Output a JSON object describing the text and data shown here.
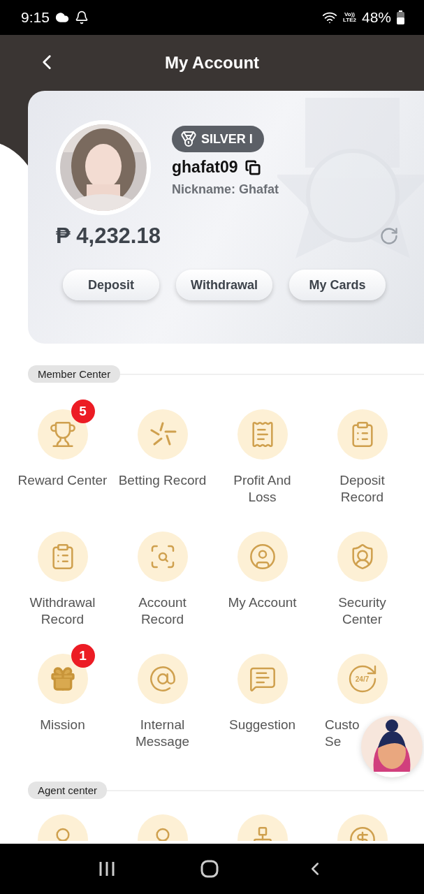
{
  "status_bar": {
    "time": "9:15",
    "volte": "Vo))",
    "network": "LTE2",
    "battery": "48%"
  },
  "header": {
    "title": "My Account"
  },
  "account_card": {
    "rank": "SILVER I",
    "username": "ghafat09",
    "nickname": "Nickname: Ghafat",
    "balance": "₱ 4,232.18",
    "buttons": [
      "Deposit",
      "Withdrawal",
      "My Cards"
    ]
  },
  "sections": [
    {
      "title": "Member Center",
      "items": [
        {
          "kind": "trophy",
          "label": "Reward Center",
          "badge": "5"
        },
        {
          "kind": "burst",
          "label": "Betting Record"
        },
        {
          "kind": "receipt",
          "label": "Profit And\nLoss"
        },
        {
          "kind": "clipboard",
          "label": "Deposit\nRecord"
        },
        {
          "kind": "clipboard",
          "label": "Withdrawal\nRecord"
        },
        {
          "kind": "scan",
          "label": "Account\nRecord"
        },
        {
          "kind": "user",
          "label": "My Account"
        },
        {
          "kind": "shield",
          "label": "Security\nCenter"
        },
        {
          "kind": "gift",
          "label": "Mission",
          "badge": "1"
        },
        {
          "kind": "at",
          "label": "Internal\nMessage"
        },
        {
          "kind": "chat",
          "label": "Suggestion"
        },
        {
          "kind": "rotate",
          "icon_text": "24/7",
          "label": "Custo\nSe"
        }
      ]
    },
    {
      "title": "Agent center",
      "items": [
        {
          "kind": "person"
        },
        {
          "kind": "person"
        },
        {
          "kind": "org"
        },
        {
          "kind": "coin"
        }
      ]
    }
  ]
}
